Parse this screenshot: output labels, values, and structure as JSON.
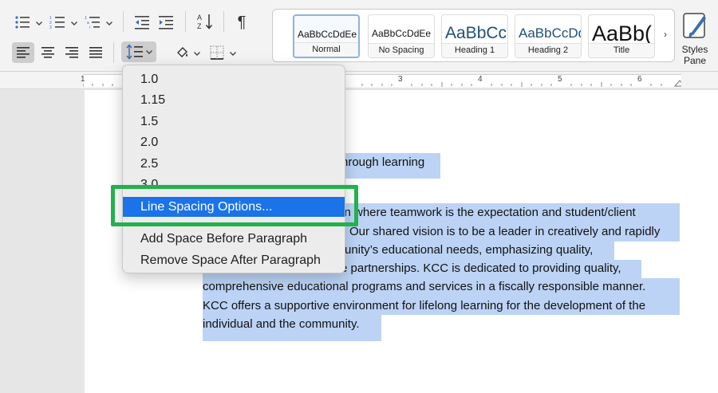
{
  "ribbon": {
    "styles": [
      {
        "sample": "AaBbCcDdEe",
        "name": "Normal"
      },
      {
        "sample": "AaBbCcDdEe",
        "name": "No Spacing"
      },
      {
        "sample": "AaBbCc",
        "name": "Heading 1"
      },
      {
        "sample": "AaBbCcDd",
        "name": "Heading 2"
      },
      {
        "sample": "AaBb(",
        "name": "Title"
      }
    ],
    "more_glyph": "›",
    "styles_pane_line1": "Styles",
    "styles_pane_line2": "Pane",
    "pilcrow": "¶",
    "accent_color": "#1a73e8"
  },
  "ruler": {
    "marks": [
      "1",
      "3",
      "4",
      "5",
      "6"
    ]
  },
  "line_spacing_menu": {
    "options": [
      "1.0",
      "1.15",
      "1.5",
      "2.0",
      "2.5",
      "3.0"
    ],
    "highlighted": "Line Spacing Options...",
    "add_space_before": "Add Space Before Paragraph",
    "remove_space_after": "Remove Space After Paragraph"
  },
  "document": {
    "lines": [
      "hrough learning",
      "tin where teamwork is the expectation and student/client",
      "Our shared vision is to be a leader in creatively and rapidly",
      "unity’s educational needs, emphasizing quality,",
      "e partnerships. KCC is dedicated to providing quality,",
      "comprehensive educational programs and services in a fiscally responsible manner.",
      "KCC offers a supportive environment for lifelong learning for the development of the",
      "individual and the community."
    ]
  }
}
